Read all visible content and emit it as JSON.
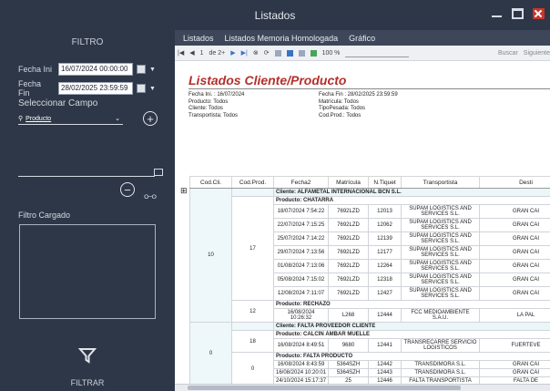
{
  "window": {
    "title": "Listados"
  },
  "left": {
    "title": "FILTRO",
    "fecha_ini_label": "Fecha Ini",
    "fecha_ini_value": "16/07/2024 00:00:00",
    "fecha_fin_label": "Fecha Fin",
    "fecha_fin_value": "28/02/2025 23:59:59",
    "seleccionar_label": "Seleccionar Campo",
    "combo_value": "Producto",
    "filtro_cargado_label": "Filtro Cargado",
    "filtrar_label": "FILTRAR"
  },
  "tabs": [
    "Listados",
    "Listados Memoria Homologada",
    "Gráfico"
  ],
  "toolbar": {
    "page_current": "1",
    "page_of": "de 2+",
    "zoom": "100 %",
    "buscar": "Buscar",
    "siguiente": "Siguiente"
  },
  "report": {
    "title": "Listados Cliente/Producto",
    "meta_left": [
      "Fecha Ini. : 16/07/2024",
      "Producto: Todos",
      "Cliente: Todos",
      "Transportista: Todos"
    ],
    "meta_right": [
      "Fecha Fin : 28/02/2025 23:59:59",
      "Matrícula: Todos",
      "TipoPesada: Todos",
      "Cod.Prod.: Todos"
    ],
    "columns": [
      "Cod.Cli.",
      "Cod.Prod.",
      "Fecha2",
      "Matrícula",
      "N.Tiquet",
      "Transportista",
      "Desti"
    ],
    "groups": [
      {
        "cliente": "Cliente:  ALFAMETAL INTERNACIONAL BCN S.L.",
        "cod_cli": "10",
        "productos": [
          {
            "cod_prod": "17",
            "label": "Producto:  CHATARRA",
            "rows": [
              [
                "18/07/2024 7:54:22",
                "7692LZD",
                "12013",
                "SUPAM LOGISTICS AND SERVICES S.L.",
                "GRAN CAI"
              ],
              [
                "22/07/2024 7:15:25",
                "7692LZD",
                "12062",
                "SUPAM LOGISTICS AND SERVICES S.L.",
                "GRAN CAI"
              ],
              [
                "25/07/2024 7:14:22",
                "7692LZD",
                "12139",
                "SUPAM LOGISTICS AND SERVICES S.L.",
                "GRAN CAI"
              ],
              [
                "29/07/2024 7:13:56",
                "7692LZD",
                "12177",
                "SUPAM LOGISTICS AND SERVICES S.L.",
                "GRAN CAI"
              ],
              [
                "01/08/2024 7:13:06",
                "7692LZD",
                "12264",
                "SUPAM LOGISTICS AND SERVICES S.L.",
                "GRAN CAI"
              ],
              [
                "05/08/2024 7:15:02",
                "7692LZD",
                "12318",
                "SUPAM LOGISTICS AND SERVICES S.L.",
                "GRAN CAI"
              ],
              [
                "12/08/2024 7:11:07",
                "7692LZD",
                "12427",
                "SUPAM LOGISTICS AND SERVICES S.L.",
                "GRAN CAI"
              ]
            ]
          },
          {
            "cod_prod": "12",
            "label": "Producto:  RECHAZO",
            "rows": [
              [
                "16/08/2024 10:26:32",
                "L268",
                "12444",
                "FCC MEDIOAMBIENTE S.A.U.",
                "LA PAL"
              ]
            ]
          }
        ]
      },
      {
        "cliente": "Cliente:  FALTA PROVEEDOR CLIENTE",
        "cod_cli": "0",
        "productos": [
          {
            "cod_prod": "18",
            "label": "Producto:  CALCÍN ÁMBAR MUELLE",
            "rows": [
              [
                "16/08/2024 8:49:51",
                "9680",
                "12441",
                "TRANSRECARRE SERVICIO LOGISTICOS",
                "FUERTEVE"
              ]
            ]
          },
          {
            "cod_prod": "0",
            "label": "Producto:  FALTA PRODUCTO",
            "rows": [
              [
                "16/08/2024 8:43:59",
                "5364SZH",
                "12442",
                "TRANSDIMORA S.L.",
                "GRAN CAI"
              ],
              [
                "16/08/2024 10:20:01",
                "5364SZH",
                "12443",
                "TRANSDIMORA S.L.",
                "GRAN CAI"
              ],
              [
                "24/10/2024 15:17:37",
                "25",
                "12446",
                "FALTA TRANSPORTISTA",
                "FALTA DE"
              ]
            ]
          }
        ]
      }
    ]
  }
}
